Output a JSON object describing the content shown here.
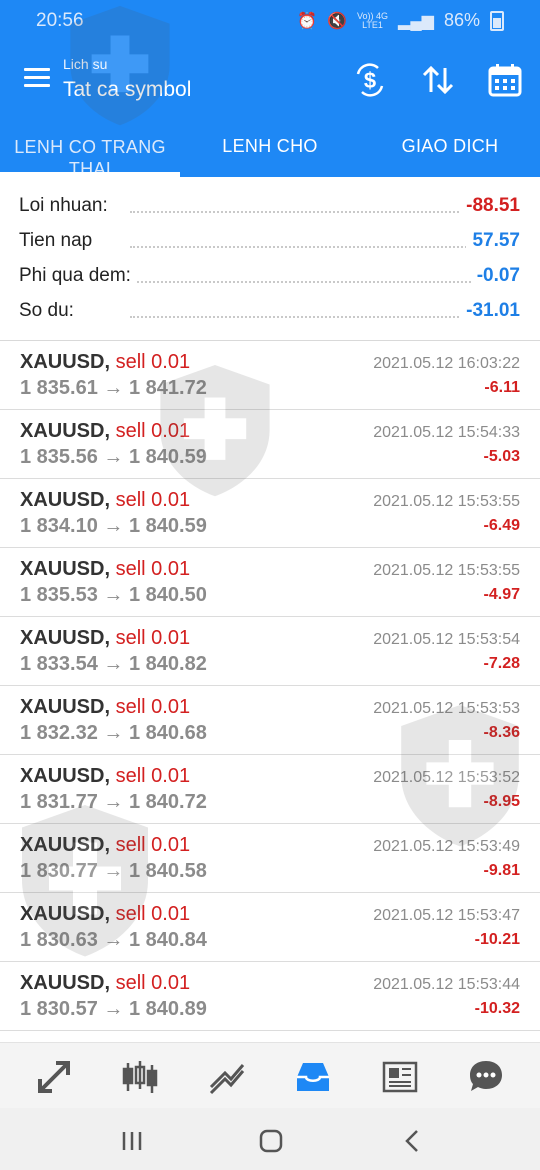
{
  "status_bar": {
    "time": "20:56",
    "network_top": "Vo)) 4G",
    "network_bottom": "LTE1",
    "battery": "86%"
  },
  "toolbar": {
    "subtitle": "Lich su",
    "title": "Tat ca symbol",
    "icons": [
      "menu-icon",
      "dollar-refresh-icon",
      "sort-arrows-icon",
      "calendar-icon"
    ]
  },
  "tabs": [
    {
      "label": "LENH CO TRANG THAI",
      "active": true
    },
    {
      "label": "LENH CHO",
      "active": false
    },
    {
      "label": "GIAO DICH",
      "active": false
    }
  ],
  "summary": [
    {
      "label": "Loi nhuan:",
      "value": "-88.51",
      "color": "#d32020"
    },
    {
      "label": "Tien nap",
      "value": "57.57",
      "color": "#1e7fe6"
    },
    {
      "label": "Phi qua dem:",
      "value": "-0.07",
      "color": "#1e7fe6"
    },
    {
      "label": "So du:",
      "value": "-31.01",
      "color": "#1e7fe6"
    }
  ],
  "trades": [
    {
      "symbol": "XAUUSD,",
      "side": "sell 0.01",
      "open": "1 835.61",
      "close": "1 841.72",
      "time": "2021.05.12 16:03:22",
      "profit": "-6.11"
    },
    {
      "symbol": "XAUUSD,",
      "side": "sell 0.01",
      "open": "1 835.56",
      "close": "1 840.59",
      "time": "2021.05.12 15:54:33",
      "profit": "-5.03"
    },
    {
      "symbol": "XAUUSD,",
      "side": "sell 0.01",
      "open": "1 834.10",
      "close": "1 840.59",
      "time": "2021.05.12 15:53:55",
      "profit": "-6.49"
    },
    {
      "symbol": "XAUUSD,",
      "side": "sell 0.01",
      "open": "1 835.53",
      "close": "1 840.50",
      "time": "2021.05.12 15:53:55",
      "profit": "-4.97"
    },
    {
      "symbol": "XAUUSD,",
      "side": "sell 0.01",
      "open": "1 833.54",
      "close": "1 840.82",
      "time": "2021.05.12 15:53:54",
      "profit": "-7.28"
    },
    {
      "symbol": "XAUUSD,",
      "side": "sell 0.01",
      "open": "1 832.32",
      "close": "1 840.68",
      "time": "2021.05.12 15:53:53",
      "profit": "-8.36"
    },
    {
      "symbol": "XAUUSD,",
      "side": "sell 0.01",
      "open": "1 831.77",
      "close": "1 840.72",
      "time": "2021.05.12 15:53:52",
      "profit": "-8.95"
    },
    {
      "symbol": "XAUUSD,",
      "side": "sell 0.01",
      "open": "1 830.77",
      "close": "1 840.58",
      "time": "2021.05.12 15:53:49",
      "profit": "-9.81"
    },
    {
      "symbol": "XAUUSD,",
      "side": "sell 0.01",
      "open": "1 830.63",
      "close": "1 840.84",
      "time": "2021.05.12 15:53:47",
      "profit": "-10.21"
    },
    {
      "symbol": "XAUUSD,",
      "side": "sell 0.01",
      "open": "1 830.57",
      "close": "1 840.89",
      "time": "2021.05.12 15:53:44",
      "profit": "-10.32"
    }
  ],
  "arrow": "→",
  "bottom_nav": [
    "quotes-icon",
    "chart-icon",
    "trade-icon",
    "history-icon",
    "news-icon",
    "chat-icon"
  ],
  "system_nav": [
    "recent-apps-icon",
    "home-icon",
    "back-icon"
  ],
  "colors": {
    "accent": "#1e88f5",
    "negative": "#d32020",
    "positive": "#1e7fe6"
  }
}
